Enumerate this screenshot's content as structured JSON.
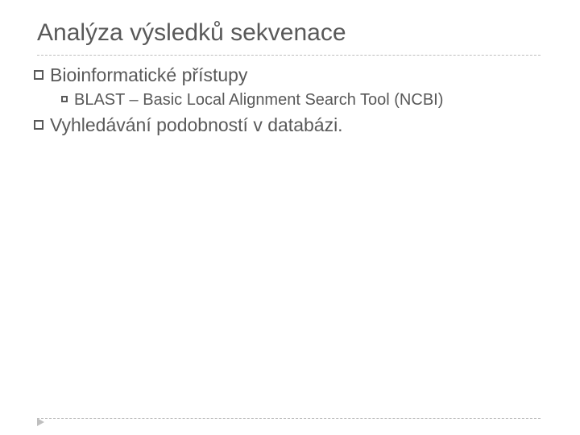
{
  "title": "Analýza výsledků sekvenace",
  "bullets": {
    "b1": "Bioinformatické přístupy",
    "b1a": "BLAST – Basic Local Alignment Search Tool (NCBI)",
    "b2": "Vyhledávání podobností v databázi."
  }
}
